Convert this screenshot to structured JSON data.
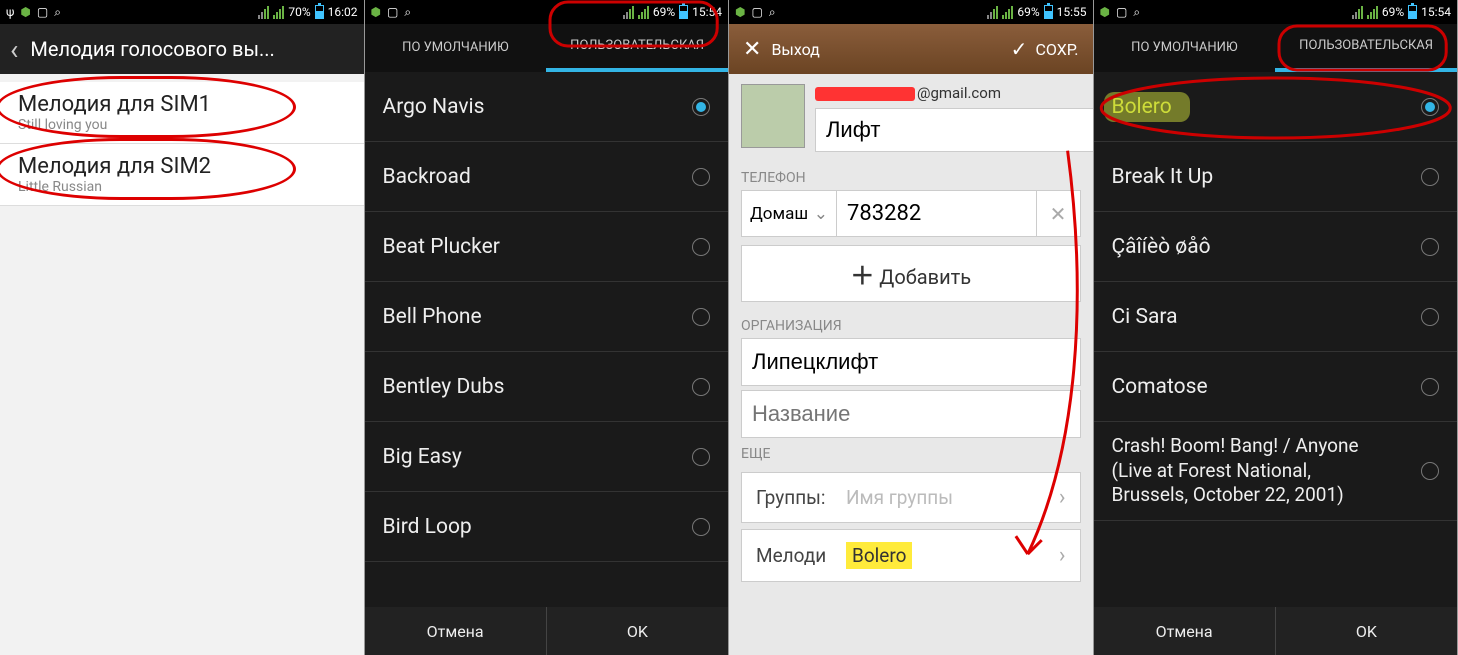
{
  "screen1": {
    "status": {
      "battery": "70%",
      "time": "16:02"
    },
    "header_title": "Мелодия голосового вы...",
    "items": [
      {
        "title": "Мелодия для SIM1",
        "sub": "Still loving you"
      },
      {
        "title": "Мелодия для SIM2",
        "sub": "Little Russian"
      }
    ]
  },
  "screen2": {
    "status": {
      "battery": "69%",
      "time": "15:54"
    },
    "tabs": {
      "default": "ПО УМОЛЧАНИЮ",
      "custom": "ПОЛЬЗОВАТЕЛЬСКАЯ"
    },
    "items": [
      "Argo Navis",
      "Backroad",
      "Beat Plucker",
      "Bell Phone",
      "Bentley Dubs",
      "Big Easy",
      "Bird Loop"
    ],
    "selected_index": 0,
    "buttons": {
      "cancel": "Отмена",
      "ok": "OK"
    }
  },
  "screen3": {
    "status": {
      "battery": "69%",
      "time": "15:55"
    },
    "header": {
      "exit": "Выход",
      "save": "СОХР."
    },
    "email_suffix": "@gmail.com",
    "name_value": "Лифт",
    "phone_section": "ТЕЛЕФОН",
    "phone_type": "Домаш",
    "phone_number": "783282",
    "add_label": "Добавить",
    "org_section": "ОРГАНИЗАЦИЯ",
    "org_value": "Липецклифт",
    "org_placeholder": "Название",
    "more_section": "ЕЩЕ",
    "groups_label": "Группы:",
    "groups_placeholder": "Имя группы",
    "ringtone_label": "Мелоди",
    "ringtone_value": "Bolero"
  },
  "screen4": {
    "status": {
      "battery": "69%",
      "time": "15:54"
    },
    "tabs": {
      "default": "ПО УМОЛЧАНИЮ",
      "custom": "ПОЛЬЗОВАТЕЛЬСКАЯ"
    },
    "items": [
      "Bolero",
      "Break It Up",
      "Çâîíèò øåô",
      "Ci Sara",
      "Comatose",
      "Crash! Boom! Bang! / Anyone (Live at Forest National, Brussels, October 22, 2001)"
    ],
    "selected_index": 0,
    "buttons": {
      "cancel": "Отмена",
      "ok": "OK"
    }
  }
}
